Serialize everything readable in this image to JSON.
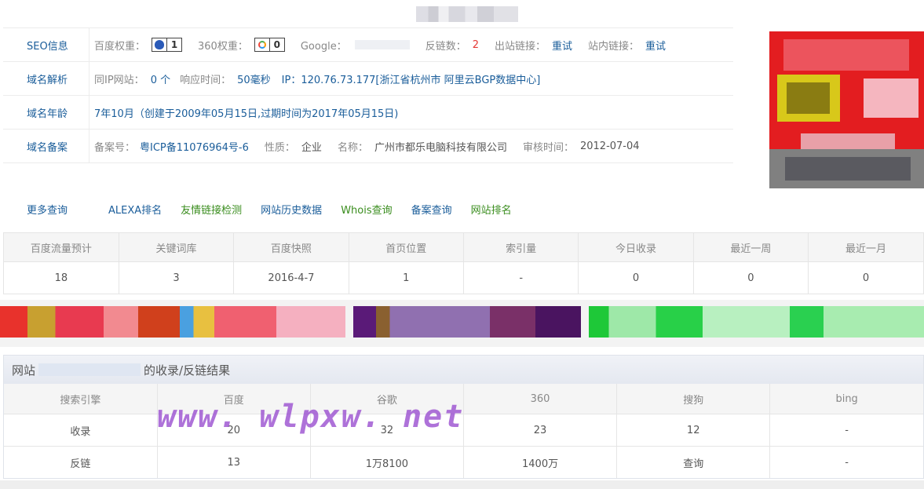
{
  "seo": {
    "label": "SEO信息",
    "baidu_label": "百度权重：",
    "baidu_value": "1",
    "s360_label": "360权重：",
    "s360_value": "0",
    "google_label": "Google：",
    "backlinks_label": "反链数：",
    "backlinks_value": "2",
    "outlinks_label": "出站链接：",
    "outlinks_value": "重试",
    "inlinks_label": "站内链接：",
    "inlinks_value": "重试"
  },
  "dns": {
    "label": "域名解析",
    "sameip_label": "同IP网站：",
    "sameip_value": "0 个",
    "resp_label": "响应时间：",
    "resp_value": "50毫秒",
    "ip_value": "IP：120.76.73.177[浙江省杭州市 阿里云BGP数据中心]"
  },
  "age": {
    "label": "域名年龄",
    "value": "7年10月（创建于2009年05月15日,过期时间为2017年05月15日)"
  },
  "beian": {
    "label": "域名备案",
    "no_label": "备案号：",
    "no_value": "粤ICP备11076964号-6",
    "type_label": "性质：",
    "type_value": "企业",
    "name_label": "名称：",
    "name_value": "广州市都乐电脑科技有限公司",
    "time_label": "审核时间：",
    "time_value": "2012-07-04"
  },
  "more": {
    "label": "更多查询",
    "links": [
      "ALEXA排名",
      "友情链接检测",
      "网站历史数据",
      "Whois查询",
      "备案查询",
      "网站排名"
    ]
  },
  "stats": {
    "headers": [
      "百度流量预计",
      "关键词库",
      "百度快照",
      "首页位置",
      "索引量",
      "今日收录",
      "最近一周",
      "最近一月"
    ],
    "values": [
      "18",
      "3",
      "2016-4-7",
      "1",
      "-",
      "0",
      "0",
      "0"
    ]
  },
  "results": {
    "title_prefix": "网站",
    "title_suffix": "的收录/反链结果",
    "headers": [
      "搜索引擎",
      "百度",
      "谷歌",
      "360",
      "搜狗",
      "bing"
    ],
    "rows": [
      [
        "收录",
        "20",
        "32",
        "23",
        "12",
        "-"
      ],
      [
        "反链",
        "13",
        "1万8100",
        "1400万",
        "查询",
        "-"
      ]
    ]
  },
  "watermark": "www. wlpxw. net",
  "colors": {
    "link_blue": "#1a5d9a",
    "link_green": "#3a8d1e",
    "accent_red": "#e53935"
  }
}
